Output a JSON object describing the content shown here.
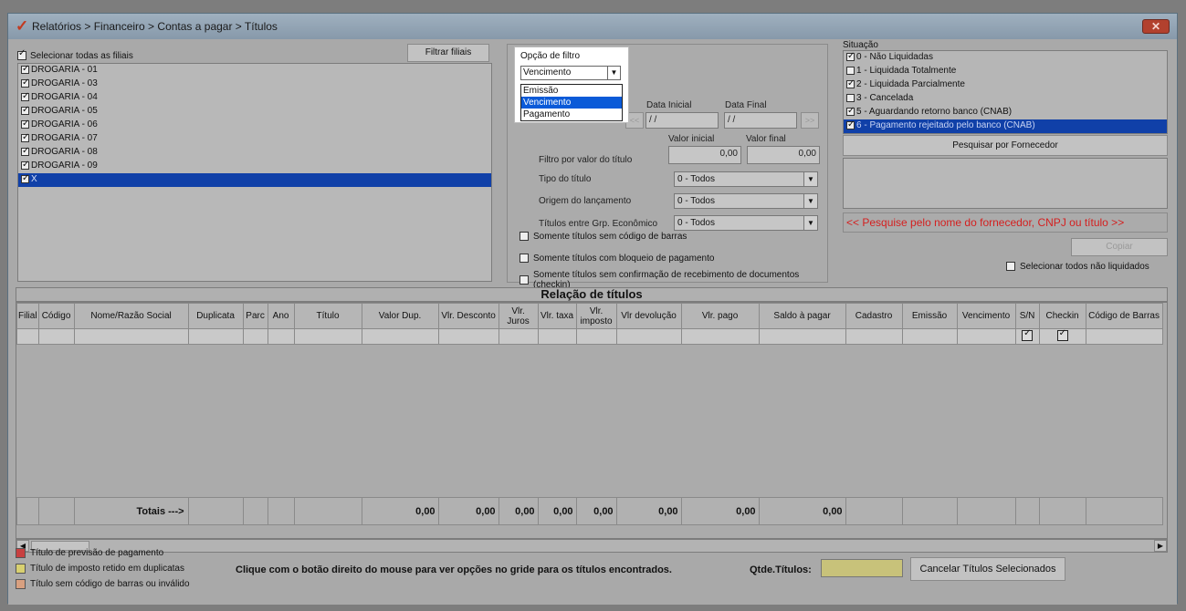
{
  "window": {
    "title": "Relatórios > Financeiro > Contas a pagar > Títulos",
    "close_glyph": "✕",
    "logo_glyph": "✓"
  },
  "branches": {
    "select_all_label": "Selecionar todas as filiais",
    "filter_button": "Filtrar filiais",
    "items": [
      {
        "label": "DROGARIA - 01",
        "checked": true
      },
      {
        "label": "DROGARIA - 03",
        "checked": true
      },
      {
        "label": "DROGARIA - 04",
        "checked": true
      },
      {
        "label": "DROGARIA - 05",
        "checked": true
      },
      {
        "label": "DROGARIA - 06",
        "checked": true
      },
      {
        "label": "DROGARIA - 07",
        "checked": true
      },
      {
        "label": "DROGARIA - 08",
        "checked": true
      },
      {
        "label": "DROGARIA - 09",
        "checked": true
      },
      {
        "label": "X",
        "checked": true,
        "selected": true
      }
    ]
  },
  "filter_option": {
    "label": "Opção de filtro",
    "value": "Vencimento",
    "options": [
      "Emissão",
      "Vencimento",
      "Pagamento"
    ],
    "selected_index": 1
  },
  "dates": {
    "start_label": "Data Inicial",
    "end_label": "Data Final",
    "start_value": "/ /",
    "end_value": "/ /",
    "prev": "<<",
    "next": ">>"
  },
  "value_filter": {
    "label": "Filtro por valor do título",
    "min_label": "Valor inicial",
    "max_label": "Valor final",
    "min_value": "0,00",
    "max_value": "0,00"
  },
  "selects": {
    "type_label": "Tipo do título",
    "type_value": "0 - Todos",
    "origin_label": "Origem do lançamento",
    "origin_value": "0 - Todos",
    "group_label": "Títulos entre Grp. Econômico",
    "group_value": "0 - Todos"
  },
  "checkboxes": {
    "no_barcode": "Somente títulos sem código de barras",
    "blocked": "Somente títulos com bloqueio de pagamento",
    "no_checkin": "Somente títulos sem confirmação de recebimento de documentos (checkin)"
  },
  "situation": {
    "label": "Situação",
    "items": [
      {
        "label": "0 - Não Liquidadas",
        "checked": true
      },
      {
        "label": "1 - Liquidada Totalmente",
        "checked": false
      },
      {
        "label": "2 - Liquidada Parcialmente",
        "checked": true
      },
      {
        "label": "3 - Cancelada",
        "checked": false
      },
      {
        "label": "5 - Aguardando retorno banco (CNAB)",
        "checked": true
      },
      {
        "label": "6 - Pagamento rejeitado pelo banco (CNAB)",
        "checked": true,
        "selected": true
      }
    ],
    "search_supplier_button": "Pesquisar por Fornecedor",
    "hint": "<< Pesquise pelo nome do fornecedor, CNPJ ou título >>",
    "copy_button": "Copiar",
    "select_all_unpaid": "Selecionar todos não liquidados"
  },
  "table": {
    "title": "Relação de títulos",
    "columns": [
      "Filial",
      "Código",
      "Nome/Razão Social",
      "Duplicata",
      "Parc",
      "Ano",
      "Título",
      "Valor Dup.",
      "Vlr. Desconto",
      "Vlr. Juros",
      "Vlr. taxa",
      "Vlr. imposto",
      "Vlr devolução",
      "Vlr. pago",
      "Saldo à pagar",
      "Cadastro",
      "Emissão",
      "Vencimento",
      "S/N",
      "Checkin",
      "Código de Barras"
    ],
    "totals_label": "Totais --->",
    "totals": {
      "valor_dup": "0,00",
      "desconto": "0,00",
      "juros": "0,00",
      "taxa": "0,00",
      "imposto": "0,00",
      "devolucao": "0,00",
      "pago": "0,00",
      "saldo": "0,00"
    }
  },
  "legend": [
    {
      "label": "Título de previsão de pagamento",
      "color": "#c84040"
    },
    {
      "label": "Título de imposto retido em duplicatas",
      "color": "#d8d070"
    },
    {
      "label": "Título sem código de barras ou inválido",
      "color": "#d8a080"
    }
  ],
  "footer": {
    "message": "Clique com o botão direito do mouse para ver opções no gride para os títulos encontrados.",
    "qtd_label": "Qtde.Títulos:",
    "qtd_value": "",
    "cancel_button": "Cancelar Títulos Selecionados"
  },
  "colors": {
    "selection": "#1040a8",
    "hint_red": "#d42020",
    "qtd_field": "#c8c27a"
  }
}
